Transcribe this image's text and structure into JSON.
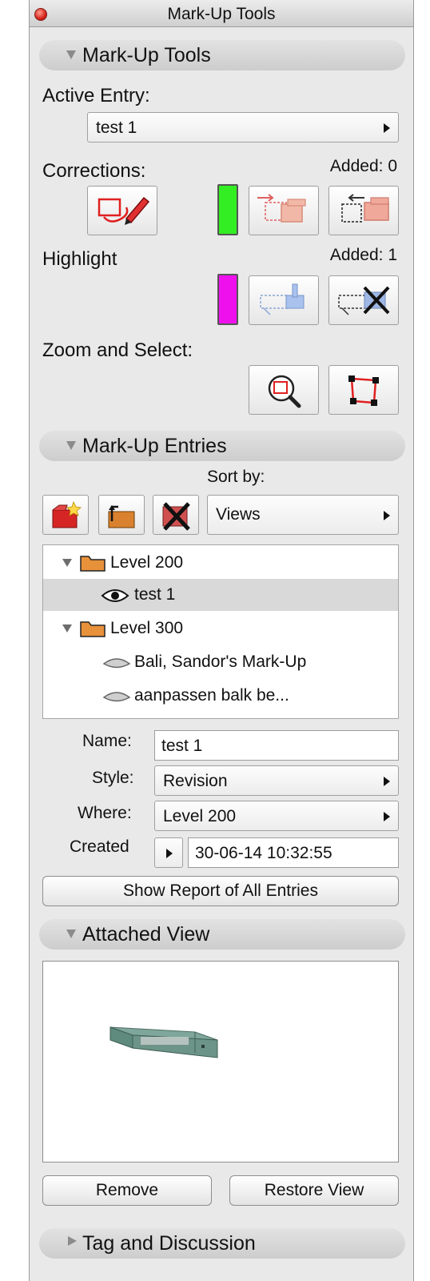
{
  "window": {
    "title": "Mark-Up Tools"
  },
  "sections": {
    "markup_tools": "Mark-Up Tools",
    "markup_entries": "Mark-Up Entries",
    "attached_view": "Attached View",
    "tag_discussion": "Tag and Discussion"
  },
  "tools": {
    "active_entry_label": "Active Entry:",
    "active_entry_value": "test 1",
    "corrections_label": "Corrections:",
    "corrections_added": "Added: 0",
    "corrections_color": "#33ee22",
    "highlight_label": "Highlight",
    "highlight_added": "Added: 1",
    "highlight_color": "#ee11ee",
    "zoom_label": "Zoom and Select:"
  },
  "entries": {
    "sort_label": "Sort by:",
    "sort_value": "Views",
    "tree": [
      {
        "label": "Level 200",
        "type": "folder",
        "level": 0
      },
      {
        "label": "test 1",
        "type": "entry-visible",
        "level": 1,
        "selected": true
      },
      {
        "label": "Level 300",
        "type": "folder",
        "level": 0
      },
      {
        "label": "Bali, Sandor's Mark-Up",
        "type": "entry",
        "level": 1
      },
      {
        "label": "aanpassen balk be...",
        "type": "entry",
        "level": 1
      }
    ]
  },
  "details": {
    "name_label": "Name:",
    "name_value": "test 1",
    "style_label": "Style:",
    "style_value": "Revision",
    "where_label": "Where:",
    "where_value": "Level 200",
    "created_label": "Created",
    "created_value": "30-06-14 10:32:55",
    "report_button": "Show Report of All Entries"
  },
  "view": {
    "remove_button": "Remove",
    "restore_button": "Restore View"
  }
}
